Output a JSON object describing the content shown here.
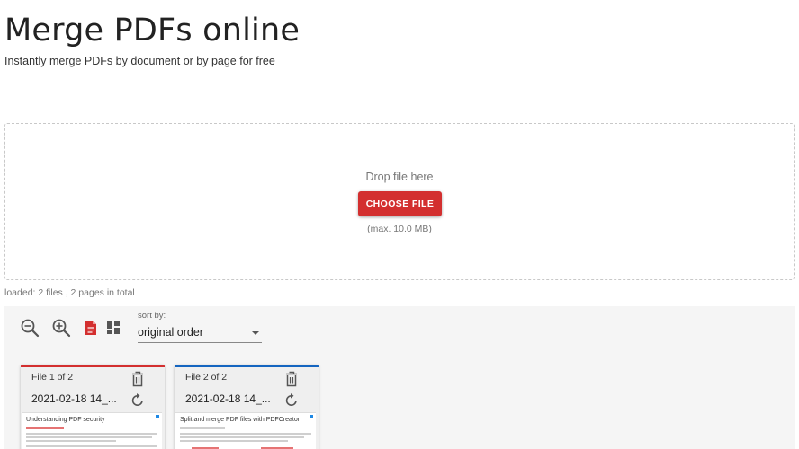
{
  "header": {
    "title": "Merge PDFs online",
    "subtitle": "Instantly merge PDFs by document or by page for free"
  },
  "upload": {
    "drop_label": "Drop file here",
    "choose_label": "CHOOSE FILE",
    "max_size": "(max. 10.0 MB)"
  },
  "status": {
    "loaded": "loaded: 2 files , 2 pages in total"
  },
  "toolbar": {
    "icons": [
      "zoom-out-icon",
      "zoom-in-icon",
      "document-view-icon",
      "page-view-icon"
    ],
    "sort_label": "sort by:",
    "sort_value": "original order"
  },
  "files": [
    {
      "number": "File 1 of 2",
      "name": "2021-02-18 14_...",
      "preview_title": "Understanding PDF security",
      "accent": "#d32f2f"
    },
    {
      "number": "File 2 of 2",
      "name": "2021-02-18 14_...",
      "preview_title": "Split and merge PDF files with PDFCreator",
      "accent": "#1565c0"
    }
  ],
  "colors": {
    "primary": "#d32f2f",
    "secondary": "#1565c0"
  }
}
